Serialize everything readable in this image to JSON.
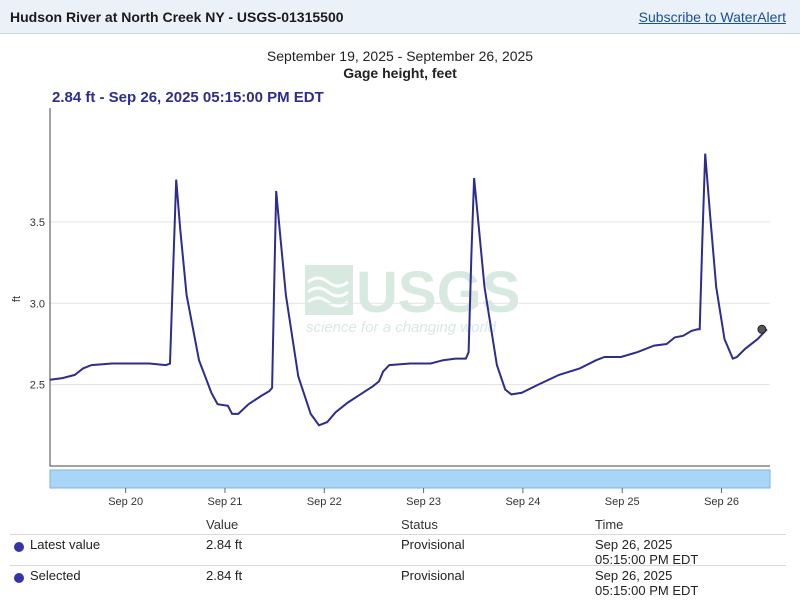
{
  "header": {
    "title": "Hudson River at North Creek NY - USGS-01315500",
    "subscribe_label": "Subscribe to WaterAlert"
  },
  "chart": {
    "date_range": "September 19, 2025 - September 26, 2025",
    "parameter": "Gage height, feet",
    "selected_readout": "2.84 ft - Sep 26, 2025 05:15:00 PM EDT",
    "watermark": {
      "logo": "USGS",
      "tagline": "science for a changing world"
    }
  },
  "chart_data": {
    "type": "line",
    "ylabel": "ft",
    "ylim": [
      2.0,
      4.2
    ],
    "yticks": [
      2.5,
      3.0,
      3.5
    ],
    "xlim": [
      "2025-09-19T12:00",
      "2025-09-26T18:00"
    ],
    "xticks": [
      {
        "label": "Sep 20",
        "date": "2025-09-20T00:00"
      },
      {
        "label": "Sep 21",
        "date": "2025-09-21T00:00"
      },
      {
        "label": "Sep 22",
        "date": "2025-09-22T00:00"
      },
      {
        "label": "Sep 23",
        "date": "2025-09-23T00:00"
      },
      {
        "label": "Sep 24",
        "date": "2025-09-24T00:00"
      },
      {
        "label": "Sep 25",
        "date": "2025-09-25T00:00"
      },
      {
        "label": "Sep 26",
        "date": "2025-09-26T00:00"
      }
    ],
    "grid": true,
    "color": "#2d2d8e",
    "series": [
      {
        "name": "",
        "points": [
          [
            "2025-09-19T12:00",
            2.53
          ],
          [
            "2025-09-19T15:00",
            2.54
          ],
          [
            "2025-09-19T18:00",
            2.56
          ],
          [
            "2025-09-19T20:00",
            2.6
          ],
          [
            "2025-09-19T22:00",
            2.62
          ],
          [
            "2025-09-20T03:00",
            2.63
          ],
          [
            "2025-09-20T12:00",
            2.63
          ],
          [
            "2025-09-20T16:00",
            2.62
          ],
          [
            "2025-09-20T17:00",
            2.63
          ],
          [
            "2025-09-20T17:45",
            3.2
          ],
          [
            "2025-09-20T18:30",
            3.76
          ],
          [
            "2025-09-20T19:30",
            3.45
          ],
          [
            "2025-09-20T21:00",
            3.05
          ],
          [
            "2025-09-21T00:00",
            2.65
          ],
          [
            "2025-09-21T03:00",
            2.45
          ],
          [
            "2025-09-21T04:30",
            2.38
          ],
          [
            "2025-09-21T07:00",
            2.37
          ],
          [
            "2025-09-21T08:00",
            2.32
          ],
          [
            "2025-09-21T09:30",
            2.32
          ],
          [
            "2025-09-21T12:00",
            2.38
          ],
          [
            "2025-09-21T15:00",
            2.43
          ],
          [
            "2025-09-21T17:00",
            2.46
          ],
          [
            "2025-09-21T17:40",
            2.48
          ],
          [
            "2025-09-21T18:15",
            3.2
          ],
          [
            "2025-09-21T18:40",
            3.69
          ],
          [
            "2025-09-21T19:30",
            3.45
          ],
          [
            "2025-09-21T21:00",
            3.05
          ],
          [
            "2025-09-22T00:00",
            2.55
          ],
          [
            "2025-09-22T03:00",
            2.32
          ],
          [
            "2025-09-22T05:00",
            2.25
          ],
          [
            "2025-09-22T07:00",
            2.27
          ],
          [
            "2025-09-22T09:00",
            2.33
          ],
          [
            "2025-09-22T12:00",
            2.39
          ],
          [
            "2025-09-22T15:00",
            2.44
          ],
          [
            "2025-09-22T18:00",
            2.49
          ],
          [
            "2025-09-22T19:30",
            2.52
          ],
          [
            "2025-09-22T20:30",
            2.58
          ],
          [
            "2025-09-22T22:00",
            2.62
          ],
          [
            "2025-09-23T03:00",
            2.63
          ],
          [
            "2025-09-23T08:00",
            2.63
          ],
          [
            "2025-09-23T11:00",
            2.65
          ],
          [
            "2025-09-23T14:00",
            2.66
          ],
          [
            "2025-09-23T16:30",
            2.66
          ],
          [
            "2025-09-23T17:10",
            2.7
          ],
          [
            "2025-09-23T17:50",
            3.3
          ],
          [
            "2025-09-23T18:30",
            3.77
          ],
          [
            "2025-09-23T19:30",
            3.5
          ],
          [
            "2025-09-23T21:00",
            3.1
          ],
          [
            "2025-09-24T00:00",
            2.62
          ],
          [
            "2025-09-24T02:00",
            2.47
          ],
          [
            "2025-09-24T03:30",
            2.44
          ],
          [
            "2025-09-24T06:00",
            2.45
          ],
          [
            "2025-09-24T10:00",
            2.5
          ],
          [
            "2025-09-24T15:00",
            2.56
          ],
          [
            "2025-09-24T20:00",
            2.6
          ],
          [
            "2025-09-25T00:00",
            2.65
          ],
          [
            "2025-09-25T02:00",
            2.67
          ],
          [
            "2025-09-25T06:00",
            2.67
          ],
          [
            "2025-09-25T10:00",
            2.7
          ],
          [
            "2025-09-25T14:00",
            2.74
          ],
          [
            "2025-09-25T17:00",
            2.75
          ],
          [
            "2025-09-25T19:00",
            2.79
          ],
          [
            "2025-09-25T21:00",
            2.8
          ],
          [
            "2025-09-25T23:00",
            2.83
          ],
          [
            "2025-09-26T00:30",
            2.84
          ],
          [
            "2025-09-26T01:00",
            2.84
          ],
          [
            "2025-09-26T01:40",
            3.4
          ],
          [
            "2025-09-26T02:20",
            3.92
          ],
          [
            "2025-09-26T03:30",
            3.55
          ],
          [
            "2025-09-26T05:00",
            3.1
          ],
          [
            "2025-09-26T07:00",
            2.78
          ],
          [
            "2025-09-26T09:00",
            2.66
          ],
          [
            "2025-09-26T10:00",
            2.67
          ],
          [
            "2025-09-26T12:00",
            2.72
          ],
          [
            "2025-09-26T15:00",
            2.78
          ],
          [
            "2025-09-26T17:15",
            2.84
          ]
        ]
      }
    ],
    "selected_point": [
      "2025-09-26T17:15",
      2.84
    ]
  },
  "table": {
    "headers": {
      "value": "Value",
      "status": "Status",
      "time": "Time"
    },
    "rows": [
      {
        "label": "Latest value",
        "value": "2.84 ft",
        "status": "Provisional",
        "date": "Sep 26, 2025",
        "time": "05:15:00 PM EDT",
        "color": "#3333aa"
      },
      {
        "label": "Selected",
        "value": "2.84 ft",
        "status": "Provisional",
        "date": "Sep 26, 2025",
        "time": "05:15:00 PM EDT",
        "color": "#3333aa"
      }
    ]
  }
}
